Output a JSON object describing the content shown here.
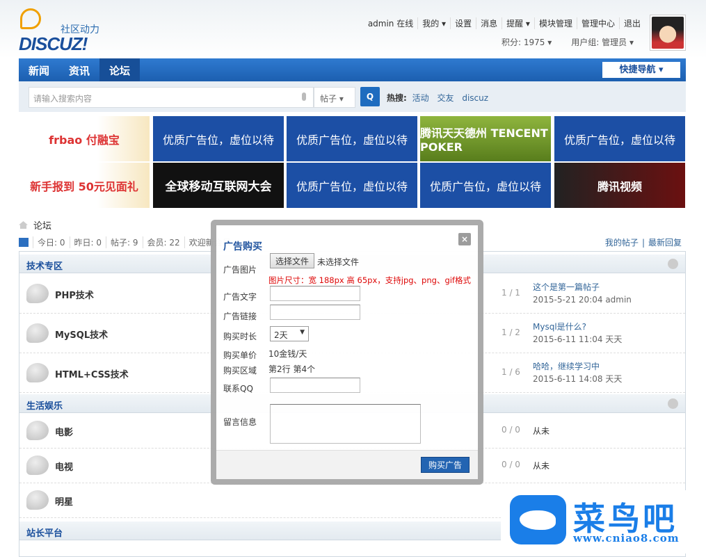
{
  "header": {
    "logo_slogan": "社区动力",
    "logo_name": "DISCUZ!",
    "user_menu": [
      "admin 在线",
      "我的 ▾",
      "设置",
      "消息",
      "提醒 ▾",
      "模块管理",
      "管理中心",
      "退出"
    ],
    "credits": "积分: 1975 ▾",
    "usergroup": "用户组: 管理员 ▾"
  },
  "nav": {
    "items": [
      "新闻",
      "资讯",
      "论坛"
    ],
    "active": 2,
    "quick_nav": "快捷导航 ▾"
  },
  "search": {
    "placeholder": "请输入搜索内容",
    "type": "帖子 ▾",
    "button": "Q",
    "hot_label": "热搜:",
    "hot": [
      "活动",
      "交友",
      "discuz"
    ]
  },
  "ads": [
    {
      "t": "frbao 付融宝",
      "c": "img1"
    },
    {
      "t": "优质广告位，虚位以待",
      "c": "blue"
    },
    {
      "t": "优质广告位，虚位以待",
      "c": "blue"
    },
    {
      "t": "腾讯天天德州 TENCENT POKER",
      "c": "green"
    },
    {
      "t": "优质广告位，虚位以待",
      "c": "blue"
    },
    {
      "t": "新手报到 50元见面礼",
      "c": "img1"
    },
    {
      "t": "全球移动互联网大会",
      "c": "black"
    },
    {
      "t": "优质广告位，虚位以待",
      "c": "blue"
    },
    {
      "t": "优质广告位，虚位以待",
      "c": "blue"
    },
    {
      "t": "腾讯视频",
      "c": "dark"
    }
  ],
  "breadcrumb": "论坛",
  "stats": [
    "今日: 0",
    "昨日: 0",
    "帖子: 9",
    "会员: 22",
    "欢迎新会员"
  ],
  "right_links": [
    "我的帖子",
    "最新回复"
  ],
  "sections": [
    {
      "name": "技术专区",
      "forums": [
        {
          "name": "PHP技术",
          "count": "1 / 1",
          "last_title": "这个是第一篇帖子",
          "last_meta": "2015-5-21 20:04 admin"
        },
        {
          "name": "MySQL技术",
          "count": "1 / 2",
          "last_title": "Mysql是什么?",
          "last_meta": "2015-6-11 11:04 天天"
        },
        {
          "name": "HTML+CSS技术",
          "count": "1 / 6",
          "last_title": "哈哈，继续学习中",
          "last_meta": "2015-6-11 14:08 天天"
        }
      ]
    },
    {
      "name": "生活娱乐",
      "forums": [
        {
          "name": "电影",
          "count": "0 / 0",
          "last_title": "从未"
        },
        {
          "name": "电视",
          "count": "0 / 0",
          "last_title": "从未"
        },
        {
          "name": "明星"
        }
      ]
    },
    {
      "name": "站长平台"
    }
  ],
  "modal": {
    "title": "广告购买",
    "close": "×",
    "labels": {
      "image": "广告图片",
      "text": "广告文字",
      "link": "广告链接",
      "duration": "购买时长",
      "price": "购买单价",
      "area": "购买区域",
      "qq": "联系QQ",
      "message": "留言信息"
    },
    "file_button": "选择文件",
    "file_none": "未选择文件",
    "hint": "图片尺寸：宽 188px 高 65px，支持jpg、png、gif格式",
    "duration": "2天",
    "price": "10金钱/天",
    "area": "第2行 第4个",
    "submit": "购买广告"
  },
  "watermark": {
    "name": "菜鸟吧",
    "url": "www.cniao8.com"
  }
}
